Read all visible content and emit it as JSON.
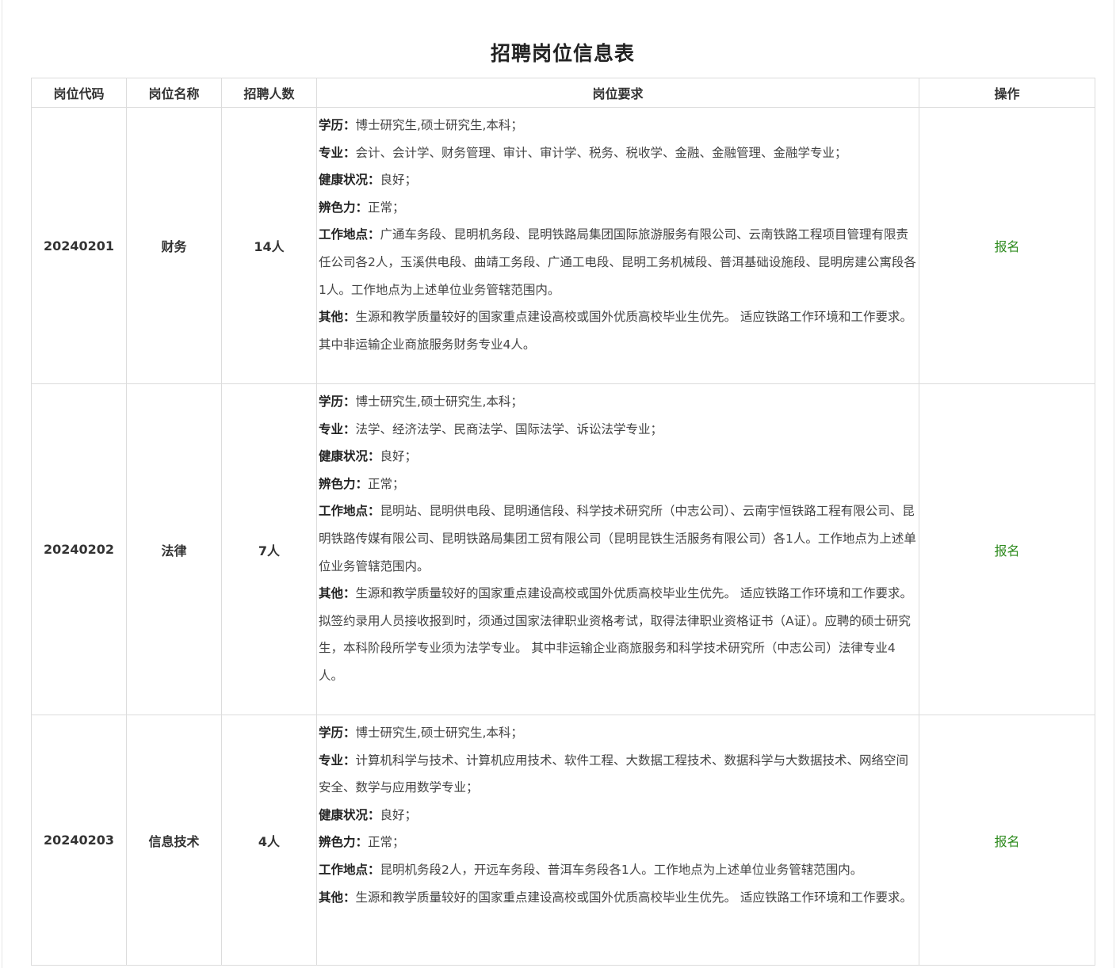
{
  "page_title": "招聘岗位信息表",
  "headers": {
    "code": "岗位代码",
    "name": "岗位名称",
    "count": "招聘人数",
    "requirements": "岗位要求",
    "action": "操作"
  },
  "colors": {
    "action_link": "#2e8b1e",
    "border": "#dcdcdc"
  },
  "rows": [
    {
      "code": "20240201",
      "name": "财务",
      "count": "14人",
      "action": "报名",
      "req": [
        {
          "k": "学历：",
          "v": "博士研究生,硕士研究生,本科；"
        },
        {
          "k": "专业：",
          "v": "会计、会计学、财务管理、审计、审计学、税务、税收学、金融、金融管理、金融学专业；"
        },
        {
          "k": "健康状况：",
          "v": "良好；"
        },
        {
          "k": "辨色力：",
          "v": "正常；"
        },
        {
          "k": "工作地点：",
          "v": "广通车务段、昆明机务段、昆明铁路局集团国际旅游服务有限公司、云南铁路工程项目管理有限责任公司各2人，玉溪供电段、曲靖工务段、广通工电段、昆明工务机械段、普洱基础设施段、昆明房建公寓段各1人。工作地点为上述单位业务管辖范围内。"
        },
        {
          "k": "其他：",
          "v": "生源和教学质量较好的国家重点建设高校或国外优质高校毕业生优先。 适应铁路工作环境和工作要求。 其中非运输企业商旅服务财务专业4人。"
        }
      ]
    },
    {
      "code": "20240202",
      "name": "法律",
      "count": "7人",
      "action": "报名",
      "req": [
        {
          "k": "学历：",
          "v": "博士研究生,硕士研究生,本科；"
        },
        {
          "k": "专业：",
          "v": "法学、经济法学、民商法学、国际法学、诉讼法学专业；"
        },
        {
          "k": "健康状况：",
          "v": "良好；"
        },
        {
          "k": "辨色力：",
          "v": "正常；"
        },
        {
          "k": "工作地点：",
          "v": "昆明站、昆明供电段、昆明通信段、科学技术研究所（中志公司）、云南宇恒铁路工程有限公司、昆明铁路传媒有限公司、昆明铁路局集团工贸有限公司（昆明昆铁生活服务有限公司）各1人。工作地点为上述单位业务管辖范围内。"
        },
        {
          "k": "其他：",
          "v": "生源和教学质量较好的国家重点建设高校或国外优质高校毕业生优先。 适应铁路工作环境和工作要求。拟签约录用人员接收报到时，须通过国家法律职业资格考试，取得法律职业资格证书（A证）。应聘的硕士研究生，本科阶段所学专业须为法学专业。 其中非运输企业商旅服务和科学技术研究所（中志公司）法律专业4人。"
        }
      ]
    },
    {
      "code": "20240203",
      "name": "信息技术",
      "count": "4人",
      "action": "报名",
      "req": [
        {
          "k": "学历：",
          "v": "博士研究生,硕士研究生,本科；"
        },
        {
          "k": "专业：",
          "v": "计算机科学与技术、计算机应用技术、软件工程、大数据工程技术、数据科学与大数据技术、网络空间安全、数学与应用数学专业；"
        },
        {
          "k": "健康状况：",
          "v": "良好；"
        },
        {
          "k": "辨色力：",
          "v": "正常；"
        },
        {
          "k": "工作地点：",
          "v": "昆明机务段2人，开远车务段、普洱车务段各1人。工作地点为上述单位业务管辖范围内。"
        },
        {
          "k": "其他：",
          "v": "生源和教学质量较好的国家重点建设高校或国外优质高校毕业生优先。 适应铁路工作环境和工作要求。"
        }
      ]
    }
  ]
}
